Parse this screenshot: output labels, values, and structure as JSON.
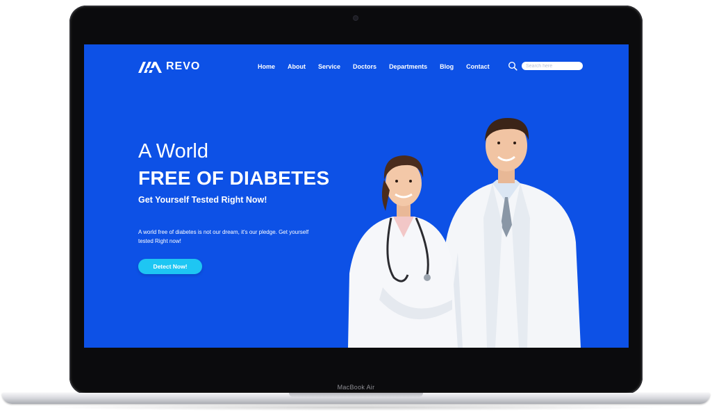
{
  "device": {
    "label": "MacBook Air"
  },
  "site": {
    "brand": "REVO",
    "nav": [
      "Home",
      "About",
      "Service",
      "Doctors",
      "Departments",
      "Blog",
      "Contact"
    ],
    "search_placeholder": "Search here"
  },
  "hero": {
    "line1": "A World",
    "line2": "FREE OF DIABETES",
    "subtitle": "Get Yourself Tested Right Now!",
    "description": "A world free of diabetes is not our dream, it's our pledge. Get yourself tested Right now!",
    "cta_label": "Detect Now!"
  },
  "colors": {
    "background": "#0d51e6",
    "cta": "#1ec6f3",
    "text": "#ffffff"
  }
}
